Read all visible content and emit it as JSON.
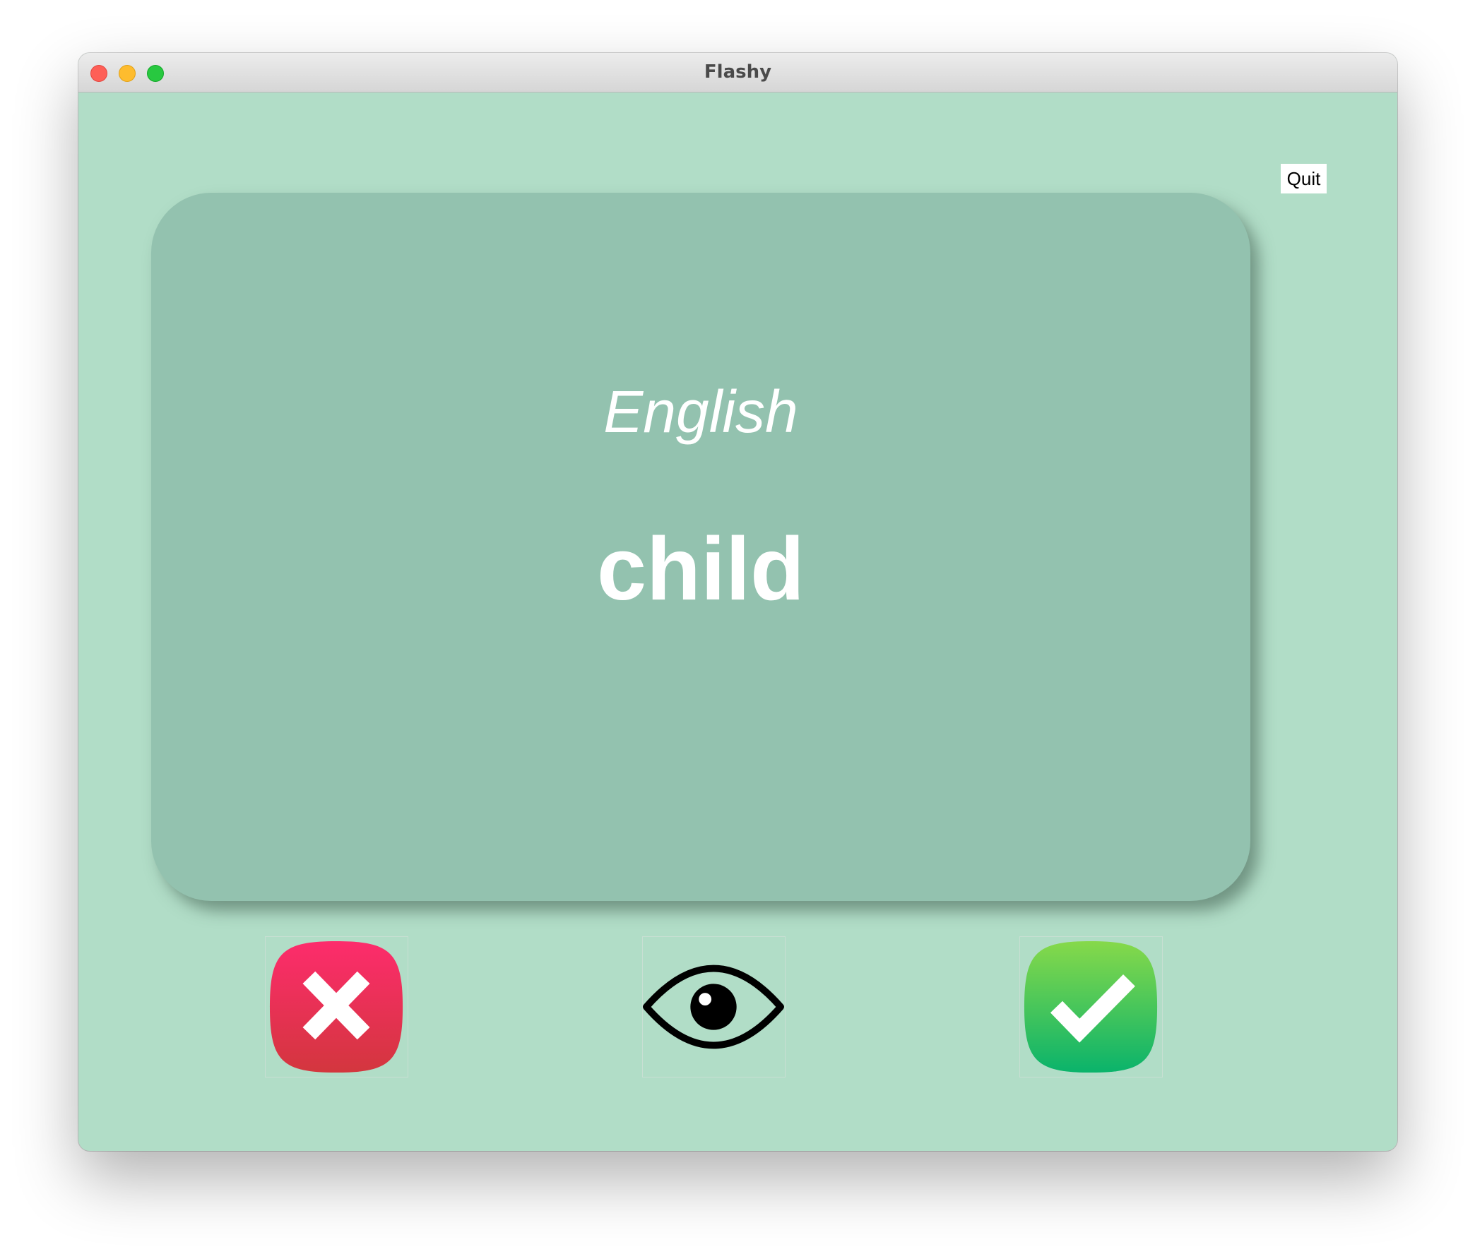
{
  "window": {
    "title": "Flashy"
  },
  "toolbar": {
    "quit_label": "Quit"
  },
  "card": {
    "language": "English",
    "word": "child",
    "background_color": "#93c2af"
  },
  "app": {
    "background_color": "#b1ddc7"
  },
  "actions": {
    "wrong": {
      "icon": "cross-icon",
      "color": "#e8335e"
    },
    "flip": {
      "icon": "eye-icon",
      "color": "#000000"
    },
    "right": {
      "icon": "checkmark-icon",
      "color": "#3cc34a"
    }
  }
}
